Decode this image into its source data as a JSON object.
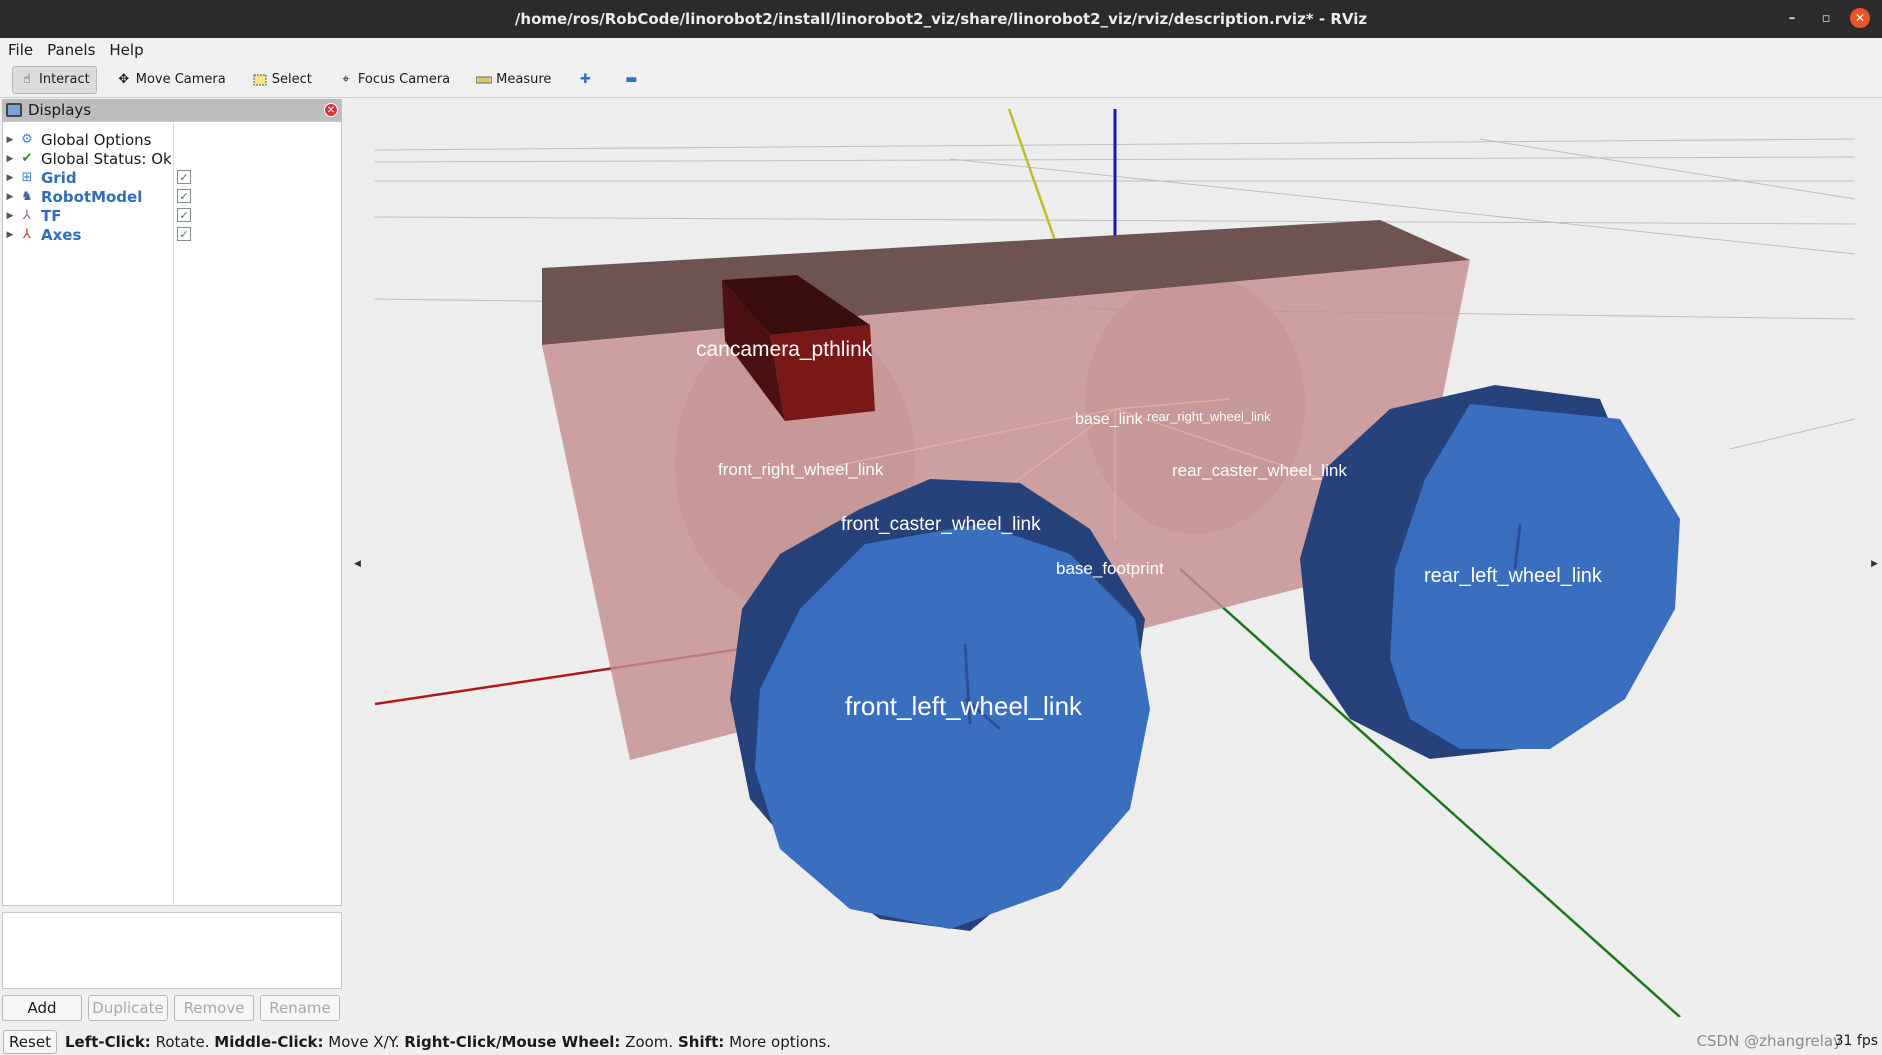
{
  "window": {
    "title": "/home/ros/RobCode/linorobot2/install/linorobot2_viz/share/linorobot2_viz/rviz/description.rviz* - RViz",
    "controls": [
      "minimize-icon",
      "maximize-icon",
      "close-icon"
    ]
  },
  "menu": {
    "file": "File",
    "panels": "Panels",
    "help": "Help"
  },
  "toolbar": {
    "interact": "Interact",
    "move_camera": "Move Camera",
    "select": "Select",
    "focus_camera": "Focus Camera",
    "measure": "Measure"
  },
  "displays": {
    "title": "Displays",
    "items": [
      {
        "label": "Global Options",
        "icon": "gear-icon"
      },
      {
        "label": "Global Status: Ok",
        "icon": "checkmark-icon"
      },
      {
        "label": "Grid",
        "icon": "grid-icon",
        "checked": true
      },
      {
        "label": "RobotModel",
        "icon": "robot-icon",
        "checked": true
      },
      {
        "label": "TF",
        "icon": "tf-icon",
        "checked": true
      },
      {
        "label": "Axes",
        "icon": "axes-icon",
        "checked": true
      }
    ],
    "buttons": {
      "add": "Add",
      "duplicate": "Duplicate",
      "remove": "Remove",
      "rename": "Rename"
    }
  },
  "status": {
    "reset": "Reset",
    "left_click_key": "Left-Click:",
    "left_click_val": "Rotate.",
    "middle_click_key": "Middle-Click:",
    "middle_click_val": "Move X/Y.",
    "right_click_key": "Right-Click/Mouse Wheel:",
    "right_click_val": "Zoom.",
    "shift_key": "Shift:",
    "shift_val": "More options.",
    "fps": "31 fps",
    "watermark": "CSDN @zhangrelay"
  },
  "scene": {
    "frames": {
      "camera": "cancamera_pthlink",
      "base_link": "base_link",
      "right_wheel": "rear_right_wheel_link",
      "front_right_wheel": "front_right_wheel_link",
      "rear_caster": "rear_caster_wheel_link",
      "front_caster": "front_caster_wheel_link",
      "base_footprint": "base_footprint",
      "rear_left_wheel": "rear_left_wheel_link",
      "front_left_wheel": "front_left_wheel_link"
    },
    "colors": {
      "body": "#c58f8f",
      "wheel": "#3a6fbf",
      "camera": "#6d1414",
      "x_axis": "#b01818",
      "y_axis": "#1a7a1a",
      "z_axis": "#1a1aa8"
    }
  }
}
